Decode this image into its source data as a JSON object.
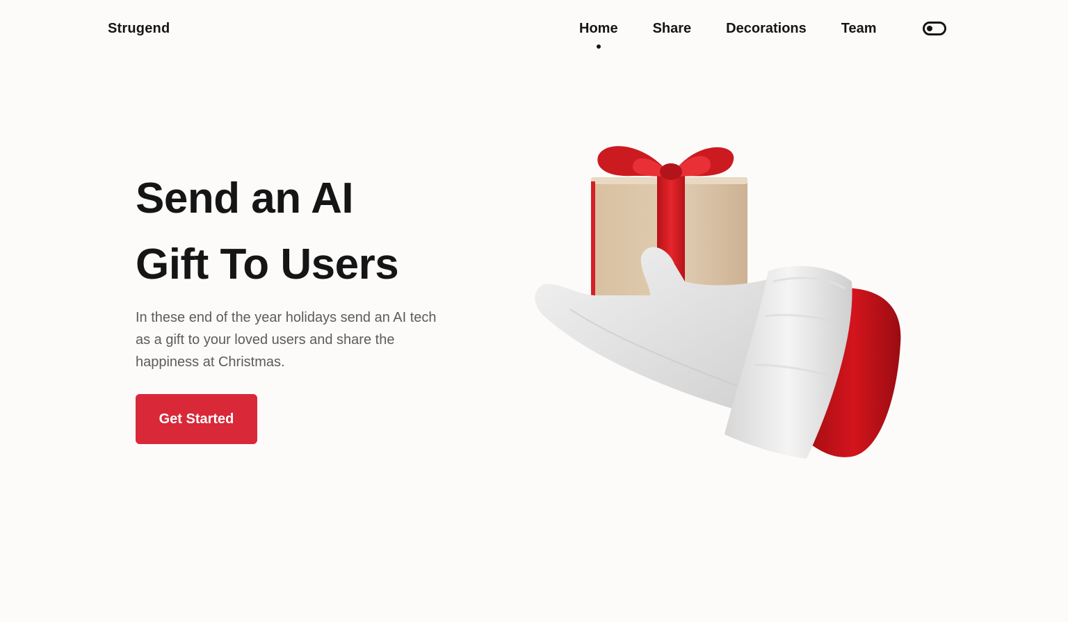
{
  "brand": {
    "name": "Strugend"
  },
  "nav": {
    "items": [
      {
        "label": "Home",
        "active": true
      },
      {
        "label": "Share",
        "active": false
      },
      {
        "label": "Decorations",
        "active": false
      },
      {
        "label": "Team",
        "active": false
      }
    ],
    "theme_toggle_icon": "toggle-switch-icon"
  },
  "hero": {
    "title_line1": "Send an AI",
    "title_line2": "Gift To Users",
    "description": "In these end of the year holidays send an AI tech as a gift to your loved users and share the happiness at Christmas.",
    "cta_label": "Get Started"
  },
  "illustration": {
    "subject": "santa-glove-holding-gift",
    "colors": {
      "accent": "#d92838",
      "box": "#d9c3a6",
      "ribbon": "#d81f26",
      "glove": "#e4e4e4",
      "cuff": "#c0121a"
    }
  },
  "colors": {
    "background": "#fcfbfa",
    "text": "#151515",
    "muted": "#5b5b5b",
    "button": "#d92838"
  }
}
